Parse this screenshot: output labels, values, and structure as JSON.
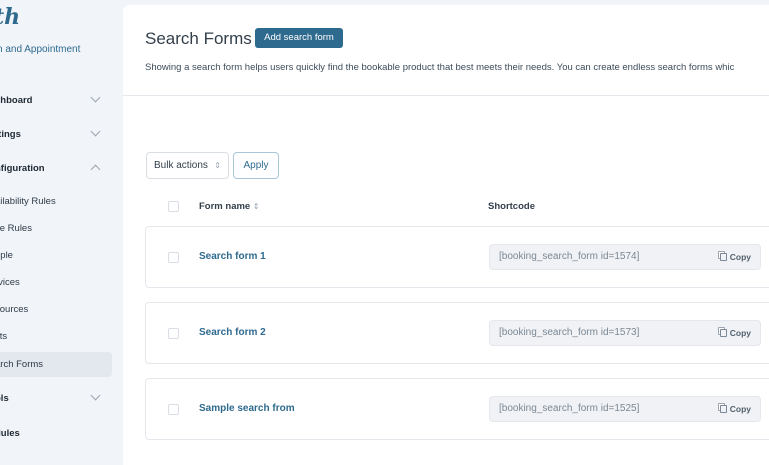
{
  "sidebar": {
    "logo": "th",
    "tagline": "n and Appointment",
    "items": [
      {
        "label": "shboard",
        "type": "top",
        "chevron": "down"
      },
      {
        "label": "ttings",
        "type": "top",
        "chevron": "down"
      },
      {
        "label": "nfiguration",
        "type": "top",
        "chevron": "up"
      },
      {
        "label": "ailability Rules",
        "type": "sub"
      },
      {
        "label": "ce Rules",
        "type": "sub"
      },
      {
        "label": "ople",
        "type": "sub"
      },
      {
        "label": "rvices",
        "type": "sub"
      },
      {
        "label": "sources",
        "type": "sub"
      },
      {
        "label": "sts",
        "type": "sub"
      },
      {
        "label": "arch Forms",
        "type": "sub",
        "active": true
      },
      {
        "label": "ols",
        "type": "top",
        "chevron": "down"
      },
      {
        "label": "dules",
        "type": "top"
      }
    ]
  },
  "header": {
    "title": "Search Forms",
    "add_label": "Add search form",
    "description": "Showing a search form helps users quickly find the bookable product that best meets their needs. You can create endless search forms whic"
  },
  "toolbar": {
    "bulk_label": "Bulk actions",
    "apply_label": "Apply"
  },
  "table": {
    "col_name": "Form name",
    "col_shortcode": "Shortcode",
    "copy_label": "Copy",
    "rows": [
      {
        "name": "Search form 1",
        "shortcode": "[booking_search_form id=1574]"
      },
      {
        "name": "Search form 2",
        "shortcode": "[booking_search_form id=1573]"
      },
      {
        "name": "Sample search from",
        "shortcode": "[booking_search_form id=1525]"
      }
    ]
  },
  "colors": {
    "accent": "#2e6a8e"
  }
}
